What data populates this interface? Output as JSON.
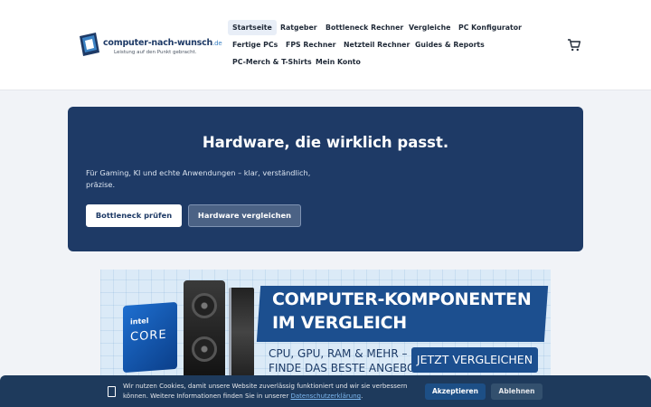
{
  "header": {
    "logo": {
      "name": "computer-nach-wunsch",
      "tld": ".de",
      "tagline": "Leistung auf den Punkt gebracht."
    },
    "nav": [
      {
        "label": "Startseite",
        "active": true
      },
      {
        "label": "Ratgeber"
      },
      {
        "label": "Bottleneck Rechner"
      },
      {
        "label": "Vergleiche"
      },
      {
        "label": "PC Konfigurator"
      },
      {
        "label": "Fertige PCs"
      },
      {
        "label": "FPS Rechner"
      },
      {
        "label": "Netzteil Rechner"
      },
      {
        "label": "Guides & Reports"
      },
      {
        "label": "PC-Merch & T-Shirts"
      },
      {
        "label": "Mein Konto"
      }
    ],
    "cart_icon": "cart-icon"
  },
  "hero": {
    "title": "Hardware, die wirklich passt.",
    "subtitle": "Für Gaming, KI und echte Anwendungen – klar, verständlich, präzise.",
    "primary_button": "Bottleneck prüfen",
    "secondary_button": "Hardware vergleichen"
  },
  "banner": {
    "cpu_brand": "intel",
    "cpu_line": "CORE",
    "headline_1": "COMPUTER-KOMPONENTEN",
    "headline_2": "IM VERGLEICH",
    "line_1": "CPU, GPU, RAM & MEHR –",
    "line_2": "FINDE DAS BESTE ANGEBOT",
    "cta": "JETZT VERGLEICHEN"
  },
  "cookie": {
    "text": "Wir nutzen Cookies, damit unsere Website zuverlässig funktioniert und wir sie verbessern können. Weitere Informationen finden Sie in unserer ",
    "link": "Datenschutzerklärung",
    "suffix": ".",
    "accept": "Akzeptieren",
    "decline": "Ablehnen"
  },
  "colors": {
    "brand": "#1e3a66",
    "page_bg": "#f1f3f7",
    "cookie_bg": "#1e3a5c",
    "accent": "#1d4f86"
  }
}
